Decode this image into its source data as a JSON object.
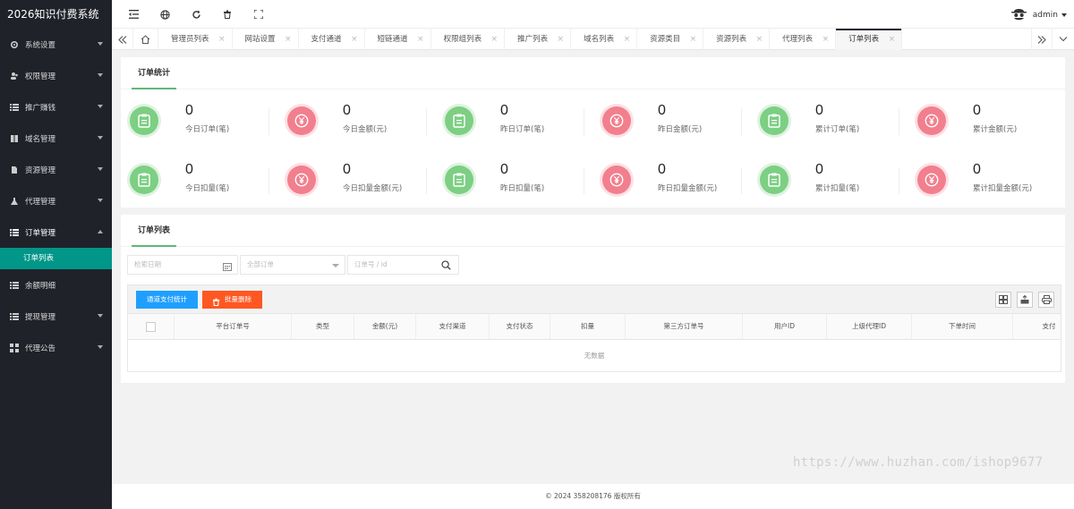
{
  "app": {
    "title": "2026知识付费系统"
  },
  "user": {
    "name": "admin"
  },
  "sidebar": {
    "items": [
      {
        "label": "系统设置"
      },
      {
        "label": "权限管理"
      },
      {
        "label": "推广赚钱"
      },
      {
        "label": "域名管理"
      },
      {
        "label": "资源管理"
      },
      {
        "label": "代理管理"
      },
      {
        "label": "订单管理"
      },
      {
        "label": "余额明细"
      },
      {
        "label": "提现管理"
      },
      {
        "label": "代理公告"
      }
    ],
    "sub_active": "订单列表"
  },
  "tabs": [
    {
      "label": "管理员列表"
    },
    {
      "label": "网站设置"
    },
    {
      "label": "支付通道"
    },
    {
      "label": "短链通道"
    },
    {
      "label": "权限组列表"
    },
    {
      "label": "推广列表"
    },
    {
      "label": "域名列表"
    },
    {
      "label": "资源类目"
    },
    {
      "label": "资源列表"
    },
    {
      "label": "代理列表"
    },
    {
      "label": "订单列表"
    }
  ],
  "tab_close": "×",
  "stats_card": {
    "title": "订单统计",
    "items": [
      {
        "value": "0",
        "label": "今日订单(笔)"
      },
      {
        "value": "0",
        "label": "今日金额(元)"
      },
      {
        "value": "0",
        "label": "昨日订单(笔)"
      },
      {
        "value": "0",
        "label": "昨日金额(元)"
      },
      {
        "value": "0",
        "label": "累计订单(笔)"
      },
      {
        "value": "0",
        "label": "累计金额(元)"
      },
      {
        "value": "0",
        "label": "今日扣量(笔)"
      },
      {
        "value": "0",
        "label": "今日扣量金额(元)"
      },
      {
        "value": "0",
        "label": "昨日扣量(笔)"
      },
      {
        "value": "0",
        "label": "昨日扣量金额(元)"
      },
      {
        "value": "0",
        "label": "累计扣量(笔)"
      },
      {
        "value": "0",
        "label": "累计扣量金额(元)"
      }
    ]
  },
  "list_card": {
    "title": "订单列表",
    "search_date_placeholder": "检索日期",
    "select_placeholder": "全部订单",
    "order_no_placeholder": "订单号 / id",
    "btn_channel_stats": "通道支付统计",
    "btn_batch_delete": "批量删除",
    "columns": [
      "平台订单号",
      "类型",
      "金额(元)",
      "支付渠道",
      "支付状态",
      "扣量",
      "第三方订单号",
      "用户ID",
      "上级代理ID",
      "下单时间",
      "支付"
    ],
    "empty_text": "无数据"
  },
  "footer": {
    "text": "© 2024 358208176 版权所有"
  },
  "watermark": "https://www.huzhan.com/ishop9677",
  "colors": {
    "sidebar_bg": "#20222a",
    "active_green": "#009688",
    "btn_blue": "#1e9fff",
    "btn_red": "#ff5722",
    "stat_green": "#7ccf83",
    "stat_red": "#f27f8d"
  }
}
